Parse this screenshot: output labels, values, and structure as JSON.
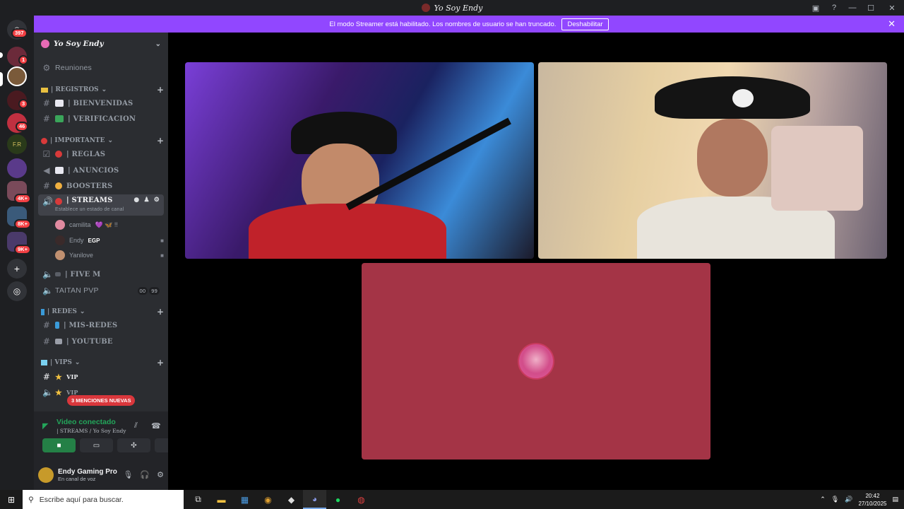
{
  "window": {
    "title": "Yo Soy Endy"
  },
  "banner": {
    "text": "El modo Streamer está habilitado. Los nombres de usuario se han truncado.",
    "button": "Deshabilitar"
  },
  "guilds": {
    "badges": [
      "397",
      "1",
      "3",
      "46",
      "4K+",
      "8K+",
      "9K+"
    ]
  },
  "server": {
    "name": "Yo Soy Endy"
  },
  "channels": {
    "meetings": "Reuniones",
    "cat_registros": "| REGISTROS",
    "bienvenidas": "| BIENVENIDAS",
    "verificacion": "| VERIFICACION",
    "cat_importante": "| IMPORTANTE",
    "reglas": "| REGLAS",
    "anuncios": "| ANUNCIOS",
    "boosters": "BOOSTERS",
    "streams": "| STREAMS",
    "streams_sub": "Establece un estado de canal",
    "five_m": "| FIVE M",
    "taitan": "TAITAN PVP",
    "taitan_counts": [
      "00",
      "99"
    ],
    "cat_redes": "| REDES",
    "mis_redes": "| MIS-REDES",
    "youtube": "| YOUTUBE",
    "cat_vips": "| VIPS",
    "vip1": "VIP",
    "vip2": "VIP"
  },
  "voice_users": [
    {
      "name": "camilita",
      "extra": "💜 🦋 !!"
    },
    {
      "name": "Endy",
      "extra": "EGP"
    },
    {
      "name": "Yanilove",
      "extra": ""
    }
  ],
  "mentions": "3 MENCIONES NUEVAS",
  "voice_panel": {
    "status": "Video conectado",
    "channel": "| STREAMS / Yo Soy Endy"
  },
  "user": {
    "name": "Endy Gaming Pro",
    "status": "En canal de voz"
  },
  "taskbar": {
    "search_placeholder": "Escribe aquí para buscar.",
    "time": "20:42",
    "date": "27/10/2025"
  },
  "colors": {
    "accent": "#9147ff",
    "connected": "#23a55a",
    "mention": "#da373c",
    "tile3": "#a43446"
  }
}
